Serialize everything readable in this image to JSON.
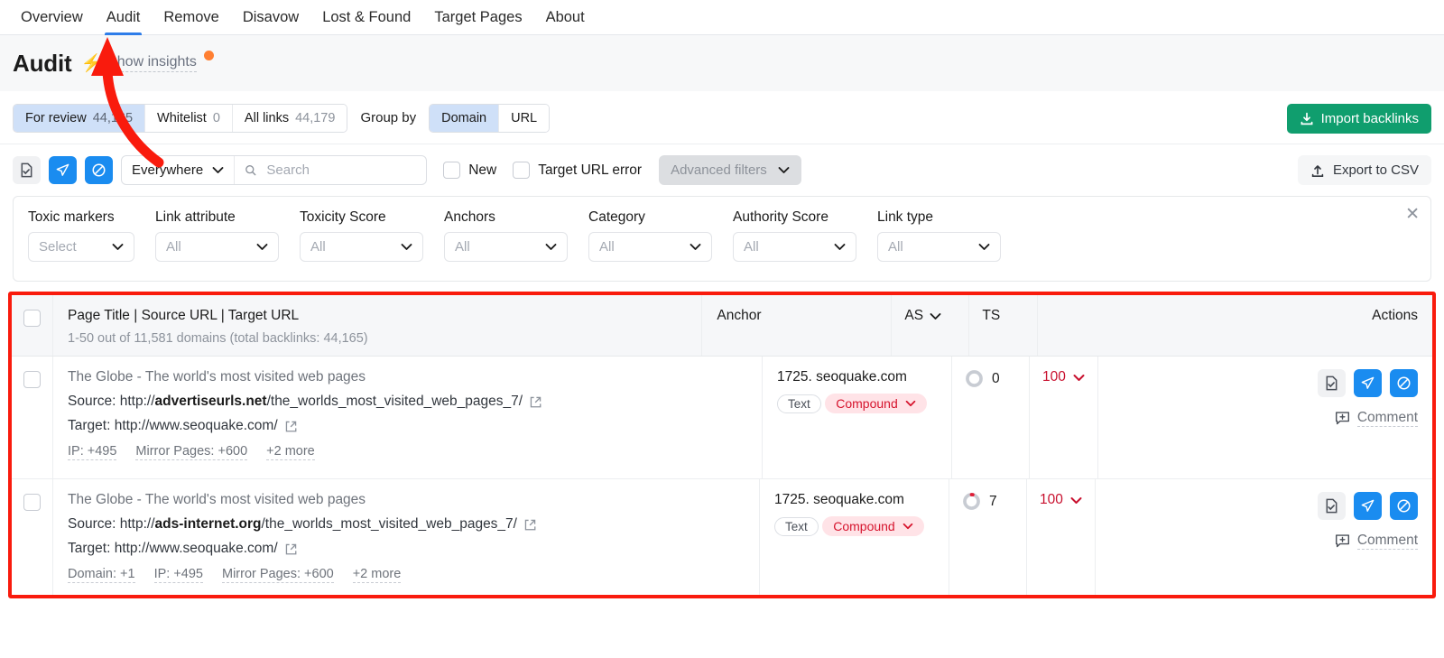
{
  "nav": {
    "items": [
      {
        "label": "Overview",
        "active": false
      },
      {
        "label": "Audit",
        "active": true
      },
      {
        "label": "Remove",
        "active": false
      },
      {
        "label": "Disavow",
        "active": false
      },
      {
        "label": "Lost & Found",
        "active": false
      },
      {
        "label": "Target Pages",
        "active": false
      },
      {
        "label": "About",
        "active": false
      }
    ]
  },
  "header": {
    "title": "Audit",
    "insights_label": "Show insights",
    "bolt_icon": "bolt-icon",
    "notification_dot_color": "#ff7f32"
  },
  "controls": {
    "tabs": [
      {
        "label": "For review",
        "count": "44,165",
        "selected": true
      },
      {
        "label": "Whitelist",
        "count": "0",
        "selected": false
      },
      {
        "label": "All links",
        "count": "44,179",
        "selected": false
      }
    ],
    "group_by_label": "Group by",
    "group_by_options": [
      {
        "label": "Domain",
        "selected": true
      },
      {
        "label": "URL",
        "selected": false
      }
    ],
    "import_button": "Import backlinks",
    "import_button_color": "#109e6e"
  },
  "filters": {
    "icon_buttons": [
      {
        "name": "move-to-whitelist-icon",
        "style": "grey"
      },
      {
        "name": "send-to-remove-icon",
        "style": "blue"
      },
      {
        "name": "send-to-disavow-icon",
        "style": "blue"
      }
    ],
    "scope_select": "Everywhere",
    "search_placeholder": "Search",
    "search_value": "",
    "checkbox_new": "New",
    "checkbox_target_url_error": "Target URL error",
    "advanced_filters": "Advanced filters",
    "export_button": "Export to CSV"
  },
  "advanced_panel": {
    "fields": [
      {
        "label": "Toxic markers",
        "value": "Select"
      },
      {
        "label": "Link attribute",
        "value": "All"
      },
      {
        "label": "Toxicity Score",
        "value": "All"
      },
      {
        "label": "Anchors",
        "value": "All"
      },
      {
        "label": "Category",
        "value": "All"
      },
      {
        "label": "Authority Score",
        "value": "All"
      },
      {
        "label": "Link type",
        "value": "All"
      }
    ]
  },
  "table": {
    "header": {
      "main": "Page Title | Source URL | Target URL",
      "subtitle": "1-50 out of 11,581 domains (total backlinks: 44,165)",
      "anchor": "Anchor",
      "as": "AS",
      "ts": "TS",
      "actions": "Actions"
    },
    "rows": [
      {
        "title": "The Globe - The world's most visited web pages",
        "source_label": "Source:",
        "source_prefix": "http://",
        "source_domain": "advertiseurls.net",
        "source_path": "/the_worlds_most_visited_web_pages_7/",
        "target_label": "Target:",
        "target_url": "http://www.seoquake.com/",
        "meta": [
          "IP: +495",
          "Mirror Pages: +600",
          "+2 more"
        ],
        "anchor": "1725. seoquake.com",
        "anchor_tag": "Text",
        "anchor_badge": "Compound",
        "as": "0",
        "ts": "100",
        "comment": "Comment"
      },
      {
        "title": "The Globe - The world's most visited web pages",
        "source_label": "Source:",
        "source_prefix": "http://",
        "source_domain": "ads-internet.org",
        "source_path": "/the_worlds_most_visited_web_pages_7/",
        "target_label": "Target:",
        "target_url": "http://www.seoquake.com/",
        "meta": [
          "Domain: +1",
          "IP: +495",
          "Mirror Pages: +600",
          "+2 more"
        ],
        "anchor": "1725. seoquake.com",
        "anchor_tag": "Text",
        "anchor_badge": "Compound",
        "as": "7",
        "ts": "100",
        "comment": "Comment"
      }
    ]
  },
  "annotation": {
    "arrow_color": "#f91b0d",
    "highlight_color": "#f91b0d"
  }
}
